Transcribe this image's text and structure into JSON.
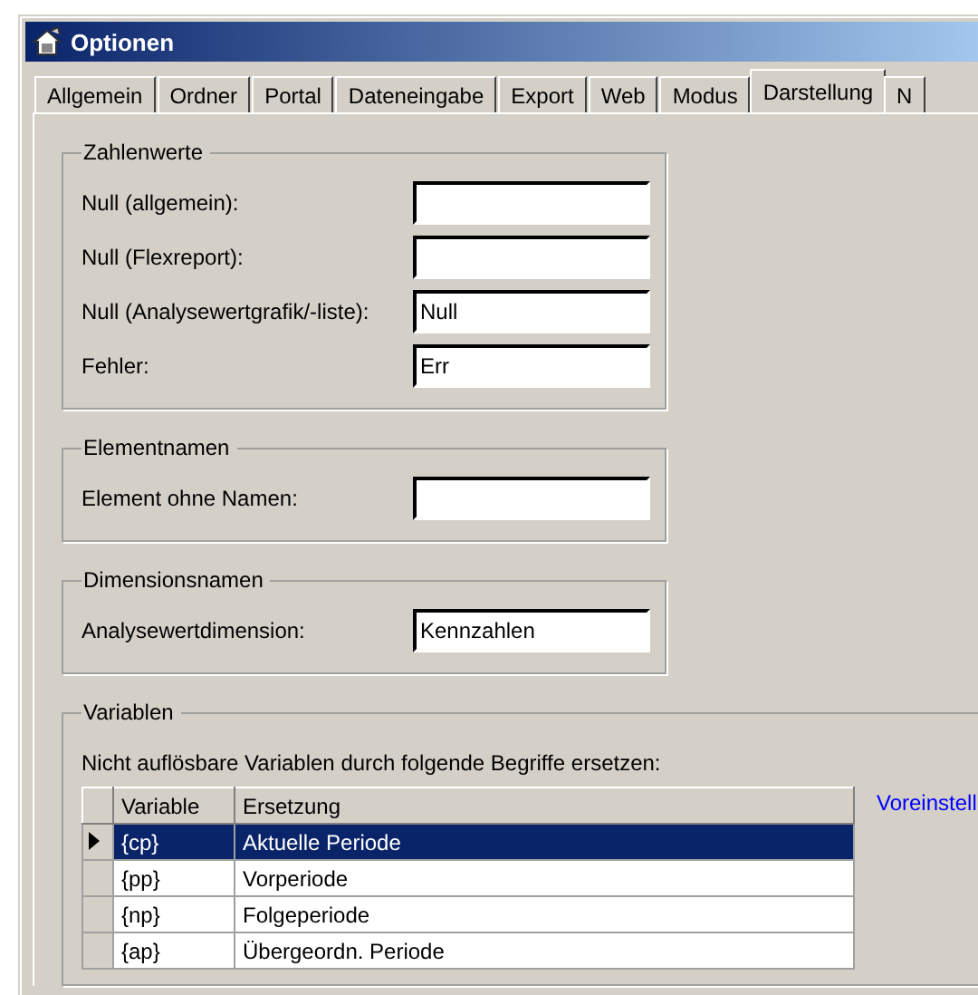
{
  "window": {
    "title": "Optionen"
  },
  "tabs": [
    {
      "label": "Allgemein",
      "selected": false
    },
    {
      "label": "Ordner",
      "selected": false
    },
    {
      "label": "Portal",
      "selected": false
    },
    {
      "label": "Dateneingabe",
      "selected": false
    },
    {
      "label": "Export",
      "selected": false
    },
    {
      "label": "Web",
      "selected": false
    },
    {
      "label": "Modus",
      "selected": false
    },
    {
      "label": "Darstellung",
      "selected": true
    },
    {
      "label": "N",
      "selected": false
    }
  ],
  "groups": [
    {
      "title": "Zahlenwerte",
      "fields": [
        {
          "label": "Null (allgemein):"
        },
        {
          "label": "Null (Flexreport):"
        },
        {
          "label": "Null (Analysewertgrafik/-liste):",
          "value": "Null"
        },
        {
          "label": "Fehler:",
          "value": "Err"
        }
      ]
    },
    {
      "title": "Elementnamen",
      "fields": [
        {
          "label": "Element ohne Namen:"
        }
      ]
    },
    {
      "title": "Dimensionsnamen",
      "fields": [
        {
          "label": "Analysewertdimension:",
          "value": "Kennzahlen"
        }
      ]
    }
  ],
  "variables": {
    "title": "Variablen",
    "description": "Nicht auflösbare Variablen durch folgende Begriffe ersetzen:",
    "columns": [
      "Variable",
      "Ersetzung"
    ],
    "rows": [
      {
        "variable": "{cp}",
        "replacement": "Aktuelle Periode",
        "selected": true
      },
      {
        "variable": "{pp}",
        "replacement": "Vorperiode",
        "selected": false
      },
      {
        "variable": "{np}",
        "replacement": "Folgeperiode",
        "selected": false
      },
      {
        "variable": "{ap}",
        "replacement": "Übergeordn. Periode",
        "selected": false
      }
    ],
    "link": "Voreinstell"
  }
}
